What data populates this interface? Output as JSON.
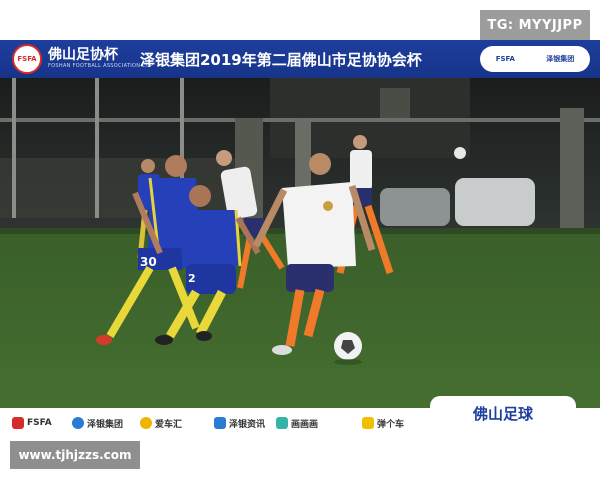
{
  "watermark_top": "TG: MYYJJPP",
  "banner": {
    "logo_text": "FSFA",
    "brand": "佛山足协杯",
    "brand_sub": "FOSHAN FOOTBALL ASSOCIATION CUP",
    "event_title": "泽银集团2019年第二届佛山市足协协会杯",
    "sponsor_left": "FSFA",
    "sponsor_right": "泽银集团"
  },
  "photo": {
    "description_icon": "soccer-match-photo",
    "players": [
      {
        "team": "blue",
        "number": "30"
      },
      {
        "team": "blue",
        "number": "2"
      },
      {
        "team": "white",
        "number": ""
      },
      {
        "team": "white",
        "number": ""
      },
      {
        "team": "white",
        "number": ""
      }
    ],
    "colors": {
      "blue_kit": "#2540b8",
      "white_kit": "#f2f2f2",
      "orange_socks": "#f07a2a",
      "grass": "#3d6a2c"
    }
  },
  "footer": {
    "sponsors": [
      "FSFA",
      "泽银集团",
      "爱车汇",
      "泽银资讯",
      "画画画",
      "弹个车"
    ],
    "brand": "佛山足球"
  },
  "watermark_bottom": "www.tjhjzzs.com"
}
